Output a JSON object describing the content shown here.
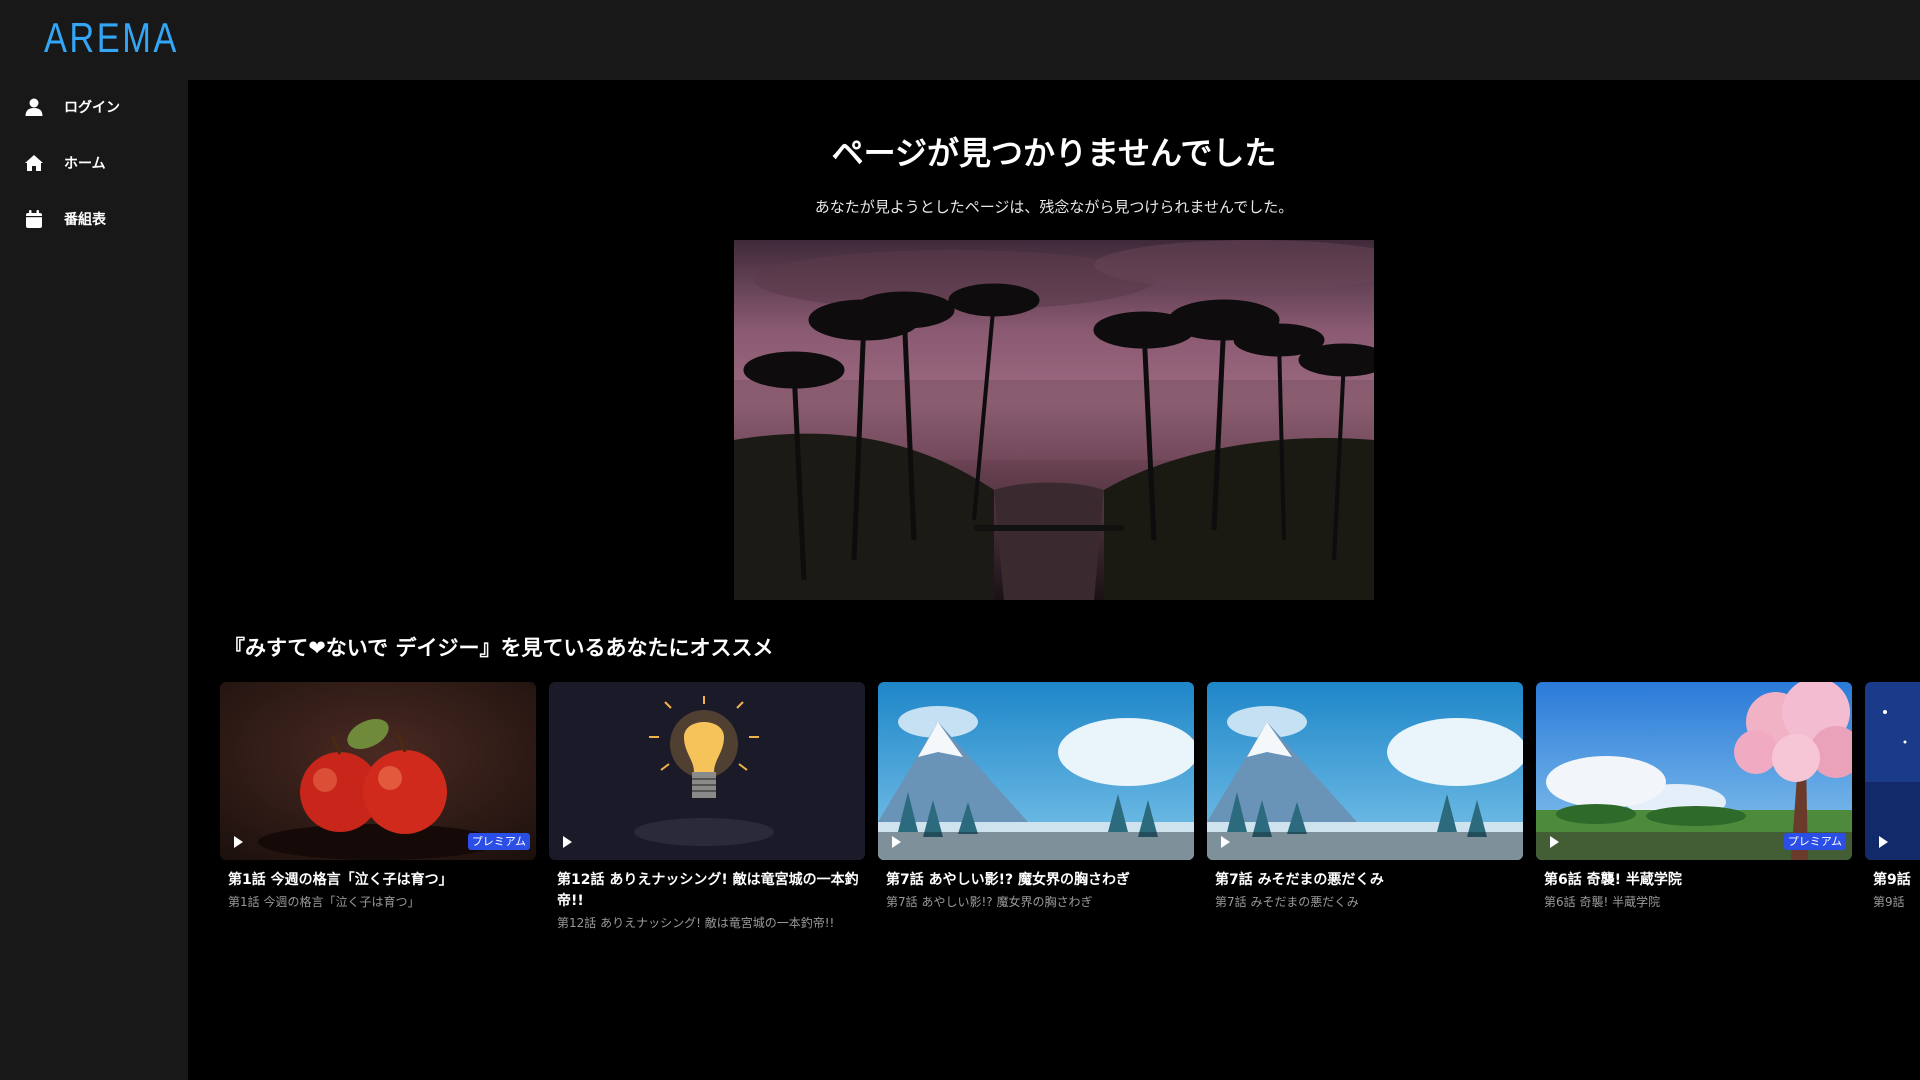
{
  "brand": {
    "logo": "AREMA",
    "accent": "#33a6f5"
  },
  "sidebar": {
    "items": [
      {
        "label": "ログイン",
        "icon": "user-icon"
      },
      {
        "label": "ホーム",
        "icon": "home-icon"
      },
      {
        "label": "番組表",
        "icon": "calendar-icon"
      }
    ]
  },
  "main": {
    "title": "ページが見つかりませんでした",
    "subtitle": "あなたが見ようとしたページは、残念ながら見つけられませんでした。",
    "section_title": "『みすて❤ないで デイジー』を見ているあなたにオススメ",
    "cards": [
      {
        "title": "第1話 今週の格言「泣く子は育つ」",
        "subtitle": "第1話 今週の格言「泣く子は育つ」",
        "badge": "プレミアム",
        "thumb": "apples"
      },
      {
        "title": "第12話 ありえナッシング! 敵は竜宮城の一本釣帝!!",
        "subtitle": "第12話 ありえナッシング! 敵は竜宮城の一本釣帝!!",
        "badge": "",
        "thumb": "lightbulb"
      },
      {
        "title": "第7話 あやしい影!? 魔女界の胸さわぎ",
        "subtitle": "第7話 あやしい影!? 魔女界の胸さわぎ",
        "badge": "",
        "thumb": "snow-mountain"
      },
      {
        "title": "第7話 みそだまの悪だくみ",
        "subtitle": "第7話 みそだまの悪だくみ",
        "badge": "",
        "thumb": "snow-mountain"
      },
      {
        "title": "第6話 奇襲! 半蔵学院",
        "subtitle": "第6話 奇襲! 半蔵学院",
        "badge": "プレミアム",
        "thumb": "cherry-blossom"
      },
      {
        "title": "第9話",
        "subtitle": "第9話",
        "badge": "",
        "thumb": "night"
      }
    ]
  }
}
